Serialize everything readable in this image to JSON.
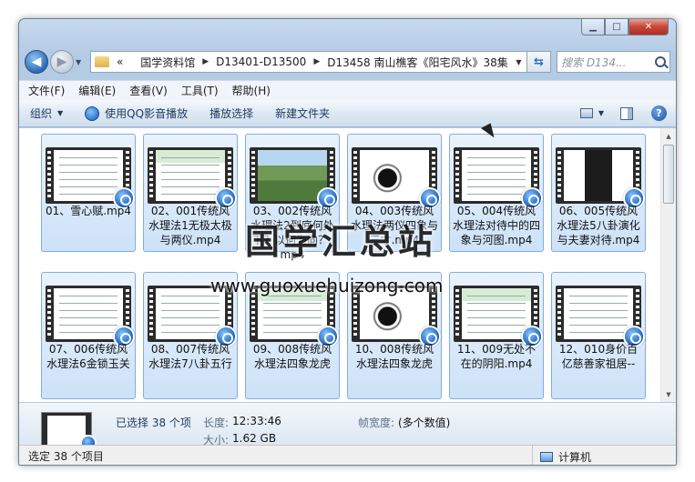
{
  "window": {
    "caption_buttons": {
      "minimize": "▁",
      "maximize": "□",
      "close": "✕"
    }
  },
  "nav": {
    "back_icon": "arrow-left-icon",
    "forward_icon": "arrow-right-icon",
    "breadcrumb_prefix": "«",
    "breadcrumb": [
      "国学资料馆",
      "D13401-D13500",
      "D13458 南山樵客《阳宅风水》38集"
    ],
    "search_placeholder": "搜索 D134..."
  },
  "menu": [
    "文件(F)",
    "编辑(E)",
    "查看(V)",
    "工具(T)",
    "帮助(H)"
  ],
  "toolbar": {
    "organize": "组织",
    "qq_play": "使用QQ影音播放",
    "play_selection": "播放选择",
    "new_folder": "新建文件夹",
    "help": "?"
  },
  "files": [
    {
      "name": "01、雪心赋.mp4",
      "thumb": "text"
    },
    {
      "name": "02、001传统风水理法1无极太极与两仪.mp4",
      "thumb": "green"
    },
    {
      "name": "03、002传统风水理法2到底何处下？以何为向？.mp4",
      "thumb": "landscape"
    },
    {
      "name": "04、003传统风水理法两仪四象与三才.mp4",
      "thumb": "taiji"
    },
    {
      "name": "05、004传统风水理法对待中的四象与河图.mp4",
      "thumb": "text"
    },
    {
      "name": "06、005传统风水理法5八卦演化与夫妻对待.mp4",
      "thumb": "dark"
    },
    {
      "name": "07、006传统风水理法6金锁玉关",
      "thumb": "text"
    },
    {
      "name": "08、007传统风水理法7八卦五行",
      "thumb": "text"
    },
    {
      "name": "09、008传统风水理法四象龙虎",
      "thumb": "green"
    },
    {
      "name": "10、008传统风水理法四象龙虎",
      "thumb": "taiji"
    },
    {
      "name": "11、009无处不在的阴阳.mp4",
      "thumb": "green"
    },
    {
      "name": "12、010身价百亿慈善家祖居--",
      "thumb": "text"
    }
  ],
  "watermark": {
    "title": "国学汇总站",
    "url": "www.guoxuehuizong.com"
  },
  "details": {
    "selected": "已选择 38 个项",
    "length_label": "长度:",
    "length_value": "12:33:46",
    "framewidth_label": "帧宽度:",
    "framewidth_value": "(多个数值)",
    "size_label": "大小:",
    "size_value": "1.62 GB"
  },
  "status": {
    "left": "选定 38 个项目",
    "computer": "计算机"
  }
}
